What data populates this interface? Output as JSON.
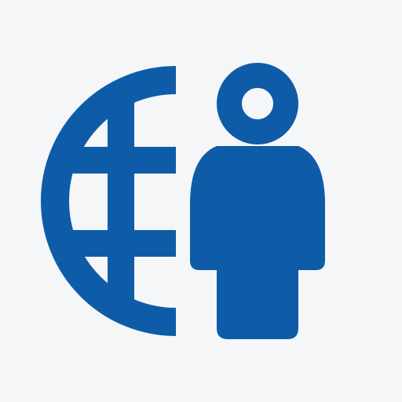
{
  "icon": {
    "name": "globe-person-icon",
    "parts": [
      "half-globe-icon",
      "person-icon"
    ],
    "color": "#0e5ca8",
    "background": "#f5f6f8"
  }
}
